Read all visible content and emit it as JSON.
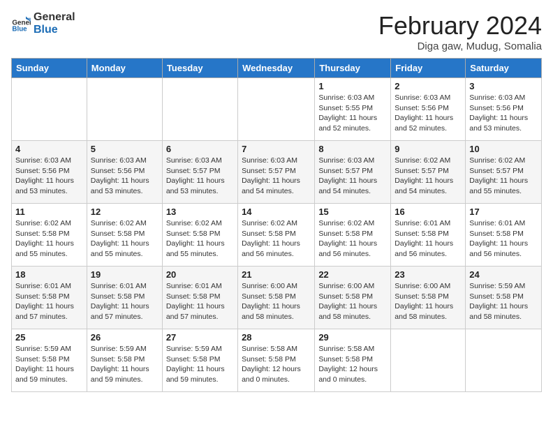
{
  "logo": {
    "line1": "General",
    "line2": "Blue"
  },
  "title": "February 2024",
  "location": "Diga gaw, Mudug, Somalia",
  "days_header": [
    "Sunday",
    "Monday",
    "Tuesday",
    "Wednesday",
    "Thursday",
    "Friday",
    "Saturday"
  ],
  "weeks": [
    [
      {
        "num": "",
        "info": ""
      },
      {
        "num": "",
        "info": ""
      },
      {
        "num": "",
        "info": ""
      },
      {
        "num": "",
        "info": ""
      },
      {
        "num": "1",
        "info": "Sunrise: 6:03 AM\nSunset: 5:55 PM\nDaylight: 11 hours\nand 52 minutes."
      },
      {
        "num": "2",
        "info": "Sunrise: 6:03 AM\nSunset: 5:56 PM\nDaylight: 11 hours\nand 52 minutes."
      },
      {
        "num": "3",
        "info": "Sunrise: 6:03 AM\nSunset: 5:56 PM\nDaylight: 11 hours\nand 53 minutes."
      }
    ],
    [
      {
        "num": "4",
        "info": "Sunrise: 6:03 AM\nSunset: 5:56 PM\nDaylight: 11 hours\nand 53 minutes."
      },
      {
        "num": "5",
        "info": "Sunrise: 6:03 AM\nSunset: 5:56 PM\nDaylight: 11 hours\nand 53 minutes."
      },
      {
        "num": "6",
        "info": "Sunrise: 6:03 AM\nSunset: 5:57 PM\nDaylight: 11 hours\nand 53 minutes."
      },
      {
        "num": "7",
        "info": "Sunrise: 6:03 AM\nSunset: 5:57 PM\nDaylight: 11 hours\nand 54 minutes."
      },
      {
        "num": "8",
        "info": "Sunrise: 6:03 AM\nSunset: 5:57 PM\nDaylight: 11 hours\nand 54 minutes."
      },
      {
        "num": "9",
        "info": "Sunrise: 6:02 AM\nSunset: 5:57 PM\nDaylight: 11 hours\nand 54 minutes."
      },
      {
        "num": "10",
        "info": "Sunrise: 6:02 AM\nSunset: 5:57 PM\nDaylight: 11 hours\nand 55 minutes."
      }
    ],
    [
      {
        "num": "11",
        "info": "Sunrise: 6:02 AM\nSunset: 5:58 PM\nDaylight: 11 hours\nand 55 minutes."
      },
      {
        "num": "12",
        "info": "Sunrise: 6:02 AM\nSunset: 5:58 PM\nDaylight: 11 hours\nand 55 minutes."
      },
      {
        "num": "13",
        "info": "Sunrise: 6:02 AM\nSunset: 5:58 PM\nDaylight: 11 hours\nand 55 minutes."
      },
      {
        "num": "14",
        "info": "Sunrise: 6:02 AM\nSunset: 5:58 PM\nDaylight: 11 hours\nand 56 minutes."
      },
      {
        "num": "15",
        "info": "Sunrise: 6:02 AM\nSunset: 5:58 PM\nDaylight: 11 hours\nand 56 minutes."
      },
      {
        "num": "16",
        "info": "Sunrise: 6:01 AM\nSunset: 5:58 PM\nDaylight: 11 hours\nand 56 minutes."
      },
      {
        "num": "17",
        "info": "Sunrise: 6:01 AM\nSunset: 5:58 PM\nDaylight: 11 hours\nand 56 minutes."
      }
    ],
    [
      {
        "num": "18",
        "info": "Sunrise: 6:01 AM\nSunset: 5:58 PM\nDaylight: 11 hours\nand 57 minutes."
      },
      {
        "num": "19",
        "info": "Sunrise: 6:01 AM\nSunset: 5:58 PM\nDaylight: 11 hours\nand 57 minutes."
      },
      {
        "num": "20",
        "info": "Sunrise: 6:01 AM\nSunset: 5:58 PM\nDaylight: 11 hours\nand 57 minutes."
      },
      {
        "num": "21",
        "info": "Sunrise: 6:00 AM\nSunset: 5:58 PM\nDaylight: 11 hours\nand 58 minutes."
      },
      {
        "num": "22",
        "info": "Sunrise: 6:00 AM\nSunset: 5:58 PM\nDaylight: 11 hours\nand 58 minutes."
      },
      {
        "num": "23",
        "info": "Sunrise: 6:00 AM\nSunset: 5:58 PM\nDaylight: 11 hours\nand 58 minutes."
      },
      {
        "num": "24",
        "info": "Sunrise: 5:59 AM\nSunset: 5:58 PM\nDaylight: 11 hours\nand 58 minutes."
      }
    ],
    [
      {
        "num": "25",
        "info": "Sunrise: 5:59 AM\nSunset: 5:58 PM\nDaylight: 11 hours\nand 59 minutes."
      },
      {
        "num": "26",
        "info": "Sunrise: 5:59 AM\nSunset: 5:58 PM\nDaylight: 11 hours\nand 59 minutes."
      },
      {
        "num": "27",
        "info": "Sunrise: 5:59 AM\nSunset: 5:58 PM\nDaylight: 11 hours\nand 59 minutes."
      },
      {
        "num": "28",
        "info": "Sunrise: 5:58 AM\nSunset: 5:58 PM\nDaylight: 12 hours\nand 0 minutes."
      },
      {
        "num": "29",
        "info": "Sunrise: 5:58 AM\nSunset: 5:58 PM\nDaylight: 12 hours\nand 0 minutes."
      },
      {
        "num": "",
        "info": ""
      },
      {
        "num": "",
        "info": ""
      }
    ]
  ]
}
